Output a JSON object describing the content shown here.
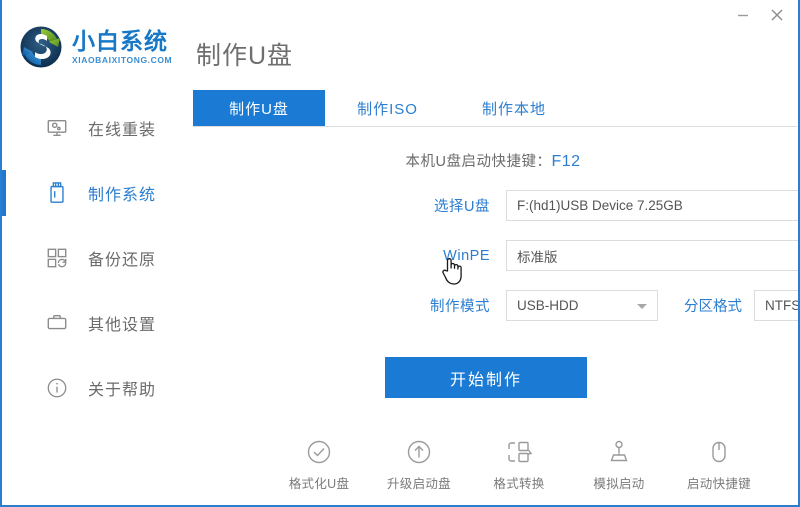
{
  "window": {
    "minimize_label": "—",
    "close_label": "✕",
    "accent_color": "#1a7ad4"
  },
  "brand": {
    "name_cn": "小白系统",
    "name_en": "XIAOBAIXITONG.COM",
    "logo_icon": "recycle-circle-logo"
  },
  "header": {
    "title": "制作U盘"
  },
  "sidebar": {
    "items": [
      {
        "label": "在线重装",
        "icon": "monitor-icon",
        "active": false
      },
      {
        "label": "制作系统",
        "icon": "usb-drive-icon",
        "active": true
      },
      {
        "label": "备份还原",
        "icon": "backup-squares-icon",
        "active": false
      },
      {
        "label": "其他设置",
        "icon": "toolbox-icon",
        "active": false
      },
      {
        "label": "关于帮助",
        "icon": "info-circle-icon",
        "active": false
      }
    ]
  },
  "tabs": [
    {
      "label": "制作U盘",
      "active": true
    },
    {
      "label": "制作ISO",
      "active": false
    },
    {
      "label": "制作本地",
      "active": false
    }
  ],
  "hotkey": {
    "text": "本机U盘启动快捷键：",
    "value": "F12"
  },
  "form": {
    "udisk": {
      "label": "选择U盘",
      "value": "F:(hd1)USB Device 7.25GB",
      "caret_icon": "chevron-down-icon"
    },
    "winpe": {
      "label": "WinPE",
      "value": "标准版",
      "caret_icon": "chevron-down-icon"
    },
    "mode": {
      "label": "制作模式",
      "value": "USB-HDD",
      "caret_icon": "chevron-down-icon"
    },
    "partition": {
      "label": "分区格式",
      "value": "NTFS",
      "caret_icon": "chevron-down-icon"
    },
    "start_button": "开始制作"
  },
  "tools": [
    {
      "label": "格式化U盘",
      "icon": "check-circle-icon"
    },
    {
      "label": "升级启动盘",
      "icon": "arrow-up-circle-icon"
    },
    {
      "label": "格式转换",
      "icon": "format-convert-icon"
    },
    {
      "label": "模拟启动",
      "icon": "joystick-icon"
    },
    {
      "label": "启动快捷键",
      "icon": "mouse-icon"
    }
  ],
  "cursor": {
    "icon": "hand-pointer-cursor"
  }
}
